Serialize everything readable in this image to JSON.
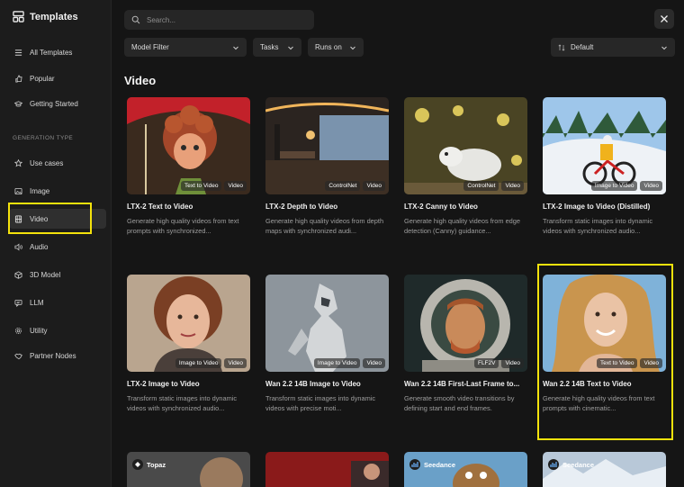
{
  "sidebar": {
    "title": "Templates",
    "items_top": [
      {
        "label": "All Templates",
        "icon": "list-icon"
      },
      {
        "label": "Popular",
        "icon": "thumbs-up-icon"
      },
      {
        "label": "Getting Started",
        "icon": "graduation-cap-icon"
      }
    ],
    "section_label": "GENERATION TYPE",
    "items": [
      {
        "label": "Use cases",
        "icon": "star-icon"
      },
      {
        "label": "Image",
        "icon": "image-icon"
      },
      {
        "label": "Video",
        "icon": "film-icon",
        "active": true
      },
      {
        "label": "Audio",
        "icon": "speaker-icon"
      },
      {
        "label": "3D Model",
        "icon": "cube-icon"
      },
      {
        "label": "LLM",
        "icon": "chat-icon"
      },
      {
        "label": "Utility",
        "icon": "gear-icon"
      },
      {
        "label": "Partner Nodes",
        "icon": "handshake-icon"
      }
    ]
  },
  "search": {
    "placeholder": "Search..."
  },
  "filters": {
    "model": "Model Filter",
    "tasks": "Tasks",
    "runs_on": "Runs on",
    "sort": "Default"
  },
  "section_title": "Video",
  "cards": [
    {
      "title": "LTX-2 Text to Video",
      "desc": "Generate high quality videos from text prompts with synchronized...",
      "badges": [
        "Text to Video",
        "Video"
      ]
    },
    {
      "title": "LTX-2 Depth to Video",
      "desc": "Generate high quality videos from depth maps with synchronized audi...",
      "badges": [
        "ControlNet",
        "Video"
      ]
    },
    {
      "title": "LTX-2 Canny to Video",
      "desc": "Generate high quality videos from edge detection (Canny) guidance...",
      "badges": [
        "ControlNet",
        "Video"
      ]
    },
    {
      "title": "LTX-2 Image to Video (Distilled)",
      "desc": "Transform static images into dynamic videos with synchronized audio...",
      "badges": [
        "Image to Video",
        "Video"
      ]
    },
    {
      "title": "LTX-2 Image to Video",
      "desc": "Transform static images into dynamic videos with synchronized audio...",
      "badges": [
        "Image to Video",
        "Video"
      ]
    },
    {
      "title": "Wan 2.2 14B Image to Video",
      "desc": "Transform static images into dynamic videos with precise moti...",
      "badges": [
        "Image to Video",
        "Video"
      ]
    },
    {
      "title": "Wan 2.2 14B First-Last Frame to...",
      "desc": "Generate smooth video transitions by defining start and end frames.",
      "badges": [
        "FLF2V",
        "Video"
      ]
    },
    {
      "title": "Wan 2.2 14B Text to Video",
      "desc": "Generate high quality videos from text prompts with cinematic...",
      "badges": [
        "Text to Video",
        "Video"
      ]
    }
  ],
  "bottom_cards": [
    {
      "brand": "Topaz"
    },
    {
      "brand": ""
    },
    {
      "brand": "Seedance"
    },
    {
      "brand": "Seedance"
    }
  ],
  "colors": {
    "highlight": "#f4e20c",
    "background": "#151515",
    "sidebar": "#1c1c1c"
  }
}
